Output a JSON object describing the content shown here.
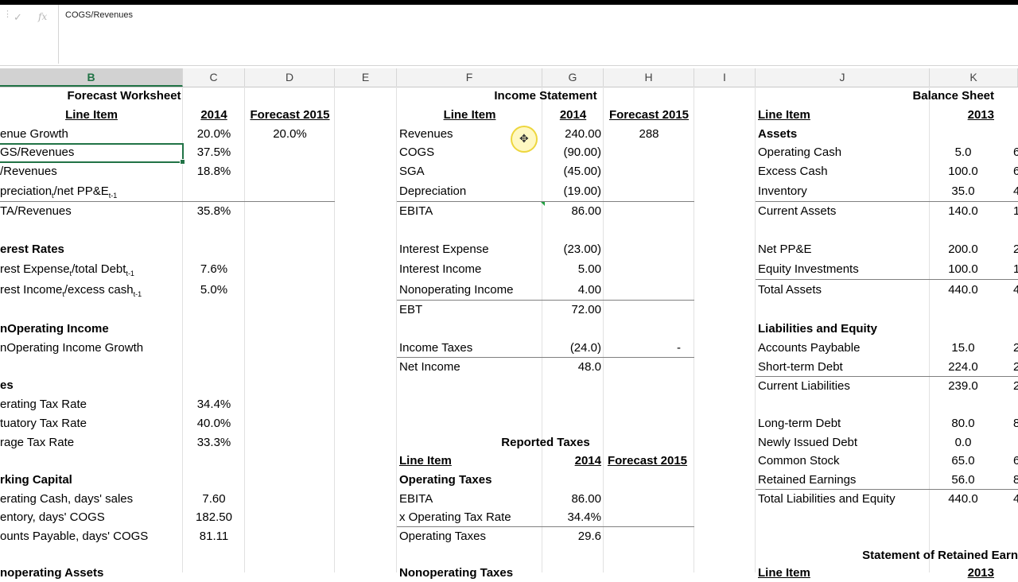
{
  "formula_bar": {
    "formula": "COGS/Revenues",
    "cancel_glyph": "✓",
    "fx_glyph": "fx",
    "splitter_glyph": "⋮"
  },
  "columns": [
    "B",
    "C",
    "D",
    "E",
    "F",
    "G",
    "H",
    "I",
    "J",
    "K"
  ],
  "selected_column": "B",
  "forecast": {
    "title": "Forecast Worksheet",
    "hdr_item": "Line Item",
    "hdr_2014": "2014",
    "hdr_forecast": "Forecast 2015",
    "rev_growth": "enue Growth",
    "rev_growth_2014": "20.0%",
    "rev_growth_2015": "20.0%",
    "cogs_rev": "GS/Revenues",
    "cogs_rev_2014": "37.5%",
    "sga_rev": "/Revenues",
    "sga_rev_2014": "18.8%",
    "dep_a": "preciation",
    "dep_sub1": "t",
    "dep_b": "/net PP&E",
    "dep_sub2": "t-1",
    "ebita_rev": "TA/Revenues",
    "ebita_rev_2014": "35.8%",
    "interest_rates": "erest Rates",
    "int_exp_a": "rest Expense",
    "int_exp_sub1": "t",
    "int_exp_b": "/total Debt",
    "int_exp_sub2": "t-1",
    "int_exp_2014": "7.6%",
    "int_inc_a": "rest Income",
    "int_inc_sub1": "t",
    "int_inc_b": "/excess cash",
    "int_inc_sub2": "t-1",
    "int_inc_2014": "5.0%",
    "nonop_income": "nOperating Income",
    "nonop_growth": "nOperating Income Growth",
    "taxes": "es",
    "op_tax": "erating Tax Rate",
    "op_tax_2014": "34.4%",
    "stat_tax": "tuatory Tax Rate",
    "stat_tax_2014": "40.0%",
    "avg_tax": "rage Tax Rate",
    "avg_tax_2014": "33.3%",
    "working_capital": "rking Capital",
    "op_cash_days": "erating Cash, days' sales",
    "op_cash_days_2014": "7.60",
    "inv_days": "entory, days' COGS",
    "inv_days_2014": "182.50",
    "ap_days": "ounts Payable, days' COGS",
    "ap_days_2014": "81.11",
    "nonop_assets": "noperating Assets"
  },
  "income": {
    "title": "Income Statement",
    "hdr_item": "Line Item",
    "hdr_2014": "2014",
    "hdr_forecast": "Forecast 2015",
    "revenues": "Revenues",
    "revenues_2014": "240.00",
    "revenues_2015": "288",
    "cogs": "COGS",
    "cogs_2014": "(90.00)",
    "sga": "SGA",
    "sga_2014": "(45.00)",
    "dep": "Depreciation",
    "dep_2014": "(19.00)",
    "ebita": "EBITA",
    "ebita_2014": "86.00",
    "int_exp": "Interest Expense",
    "int_exp_2014": "(23.00)",
    "int_inc": "Interest Income",
    "int_inc_2014": "5.00",
    "nonop": "Nonoperating Income",
    "nonop_2014": "4.00",
    "ebt": "EBT",
    "ebt_2014": "72.00",
    "taxes": "Income Taxes",
    "taxes_2014": "(24.0)",
    "taxes_2015": "-",
    "net": "Net Income",
    "net_2014": "48.0"
  },
  "reported_taxes": {
    "title": "Reported Taxes",
    "hdr_item": "Line Item",
    "hdr_2014": "2014",
    "hdr_forecast": "Forecast 2015",
    "op_taxes_hdr": "Operating Taxes",
    "ebita": "EBITA",
    "ebita_2014": "86.00",
    "x_rate": "x Operating Tax Rate",
    "x_rate_2014": "34.4%",
    "op_taxes": "Operating Taxes",
    "op_taxes_2014": "29.6",
    "nonop_taxes": "Nonoperating Taxes"
  },
  "balance": {
    "title": "Balance Sheet",
    "hdr_item": "Line Item",
    "hdr_2013": "2013",
    "assets": "Assets",
    "op_cash": "Operating Cash",
    "op_cash_2013": "5.0",
    "op_cash_next": "6",
    "excess_cash": "Excess Cash",
    "excess_cash_2013": "100.0",
    "excess_cash_next": "6",
    "inventory": "Inventory",
    "inventory_2013": "35.0",
    "inventory_next": "4",
    "cur_assets": "Current Assets",
    "cur_assets_2013": "140.0",
    "cur_assets_next": "1",
    "ppe": "Net PP&E",
    "ppe_2013": "200.0",
    "ppe_next": "2",
    "eq_inv": "Equity Investments",
    "eq_inv_2013": "100.0",
    "eq_inv_next": "1",
    "total_assets": "Total Assets",
    "total_assets_2013": "440.0",
    "total_assets_next": "4",
    "liab_eq": "Liabilities and Equity",
    "ap": "Accounts Paybable",
    "ap_2013": "15.0",
    "ap_next": "2",
    "st_debt": "Short-term Debt",
    "st_debt_2013": "224.0",
    "st_debt_next": "2",
    "cur_liab": "Current Liabilities",
    "cur_liab_2013": "239.0",
    "cur_liab_next": "2",
    "lt_debt": "Long-term Debt",
    "lt_debt_2013": "80.0",
    "lt_debt_next": "8",
    "new_debt": "Newly Issued Debt",
    "new_debt_2013": "0.0",
    "common": "Common Stock",
    "common_2013": "65.0",
    "common_next": "6",
    "retained": "Retained Earnings",
    "retained_2013": "56.0",
    "retained_next": "8",
    "total_le": "Total Liabilities and Equity",
    "total_le_2013": "440.0",
    "total_le_next": "4",
    "sre_title": "Statement of Retained Earn",
    "sre_item": "Line Item",
    "sre_2013": "2013"
  },
  "colors": {
    "accent": "#217346",
    "cursor": "#f5e04a"
  }
}
